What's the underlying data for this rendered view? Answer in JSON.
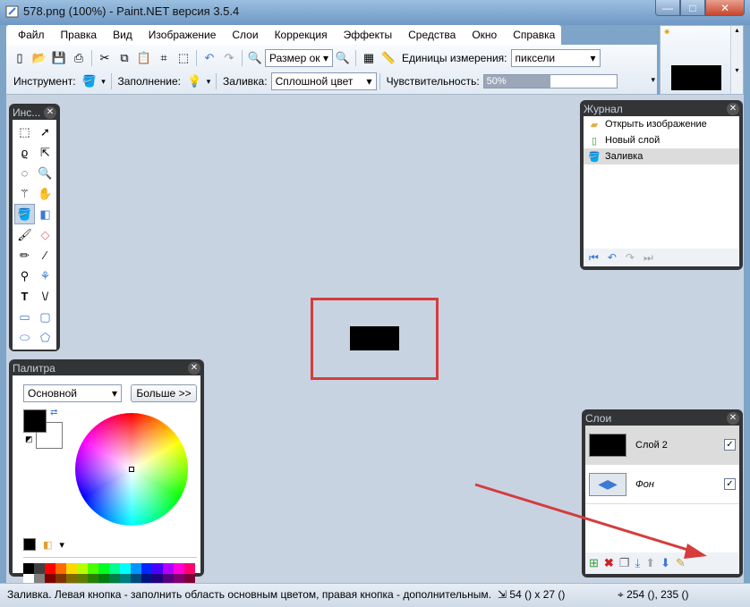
{
  "window": {
    "title": "578.png (100%) - Paint.NET версия 3.5.4",
    "min": "—",
    "max": "□",
    "close": "✕"
  },
  "menu": [
    "Файл",
    "Правка",
    "Вид",
    "Изображение",
    "Слои",
    "Коррекция",
    "Эффекты",
    "Средства",
    "Окно",
    "Справка"
  ],
  "toolbar": {
    "zoom_value": "Размер ок",
    "units_label": "Единицы измерения:",
    "units_value": "пиксели",
    "tool_label": "Инструмент:",
    "fill_label": "Заполнение:",
    "fill_mode_label": "Заливка:",
    "fill_mode_value": "Сплошной цвет",
    "tolerance_label": "Чувствительность:",
    "tolerance_value": "50%",
    "tolerance_fraction": 0.5
  },
  "tools_panel": {
    "title": "Инс..."
  },
  "history_panel": {
    "title": "Журнал",
    "items": [
      {
        "label": "Открыть изображение",
        "icon": "folder-icon"
      },
      {
        "label": "Новый слой",
        "icon": "new-layer-icon"
      },
      {
        "label": "Заливка",
        "icon": "paint-bucket-icon"
      }
    ]
  },
  "palette_panel": {
    "title": "Палитра",
    "palette_value": "Основной",
    "more_button": "Больше >>",
    "primary_color": "#000000",
    "secondary_color": "#ffffff",
    "swatches_top": [
      "#000000",
      "#404040",
      "#ff0000",
      "#ff6a00",
      "#ffd800",
      "#b6ff00",
      "#4cff00",
      "#00ff21",
      "#00ff90",
      "#00ffff",
      "#0094ff",
      "#0026ff",
      "#4800ff",
      "#b200ff",
      "#ff00dc",
      "#ff006e"
    ],
    "swatches_bottom": [
      "#ffffff",
      "#808080",
      "#7f0000",
      "#7f3300",
      "#7f6a00",
      "#5b7f00",
      "#267f00",
      "#007f0e",
      "#007f46",
      "#007f7f",
      "#004a7f",
      "#00137f",
      "#21007f",
      "#57007f",
      "#7f006e",
      "#7f0037"
    ]
  },
  "layers_panel": {
    "title": "Слои",
    "layers": [
      {
        "name": "Слой 2",
        "visible": "✓"
      },
      {
        "name": "Фон",
        "visible": "✓"
      }
    ]
  },
  "status": {
    "hint": "Заливка. Левая кнопка - заполнить область основным цветом, правая кнопка - дополнительным.",
    "size": "54 () x 27 ()",
    "position": "254 (), 235 ()"
  },
  "colors": {
    "annotation_red": "#d53c3c",
    "canvas_bg": "#c8d3e2"
  }
}
